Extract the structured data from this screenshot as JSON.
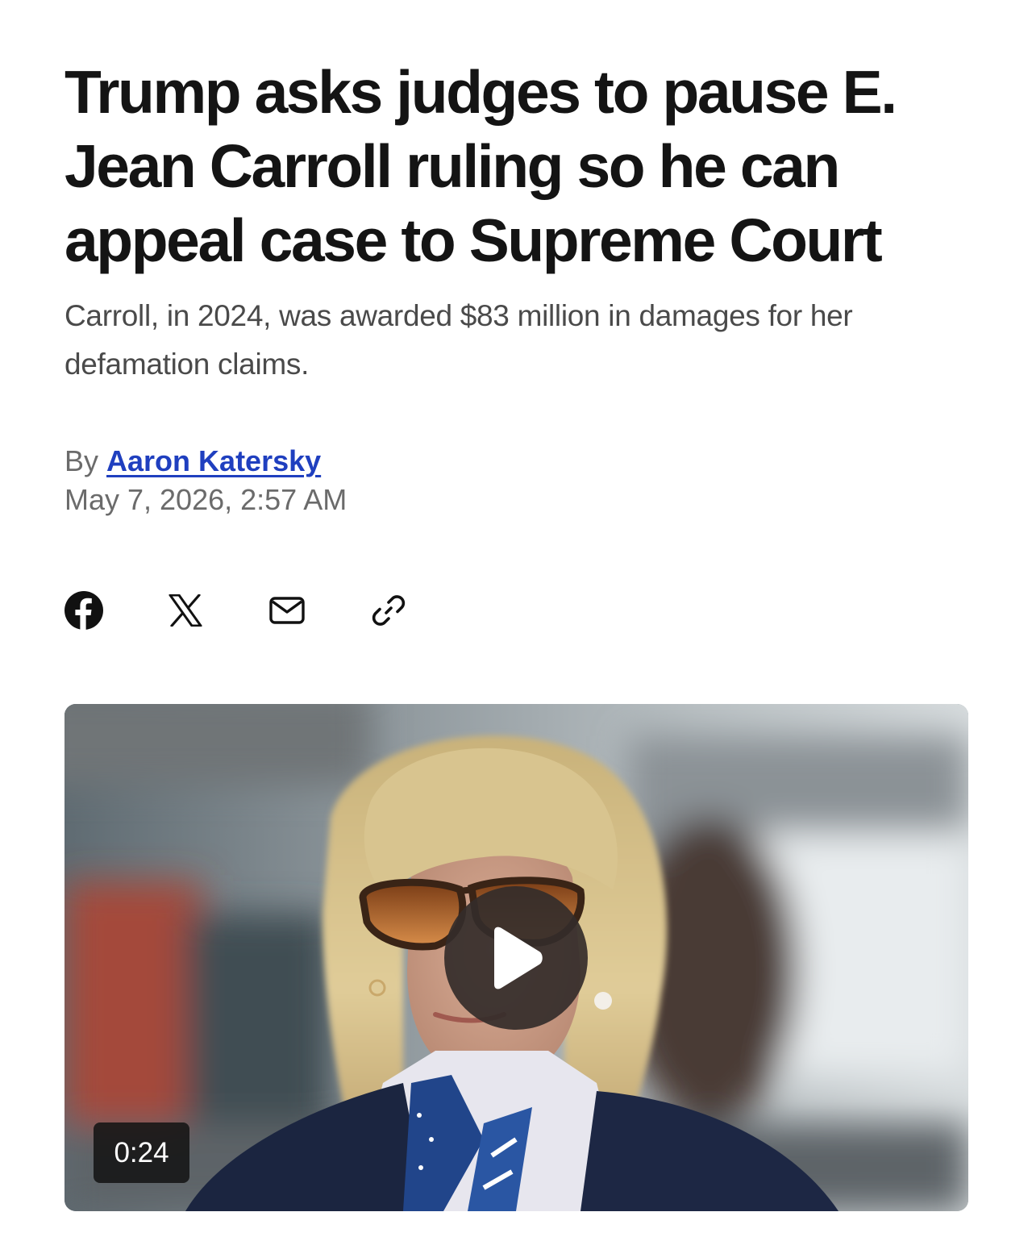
{
  "article": {
    "headline": "Trump asks judges to pause E. Jean Carroll ruling so he can appeal case to Supreme Court",
    "subheadline": "Carroll, in 2024, was awarded $83 million in damages for her defamation claims.",
    "byline_prefix": "By",
    "author": "Aaron Katersky",
    "date": "May 7, 2026, 2:57 AM"
  },
  "share": {
    "items": [
      {
        "name": "facebook",
        "icon": "facebook-icon"
      },
      {
        "name": "x",
        "icon": "x-icon"
      },
      {
        "name": "email",
        "icon": "mail-icon"
      },
      {
        "name": "copy-link",
        "icon": "link-icon"
      }
    ]
  },
  "video": {
    "duration": "0:24",
    "play_icon": "play-icon"
  },
  "colors": {
    "headline": "#141414",
    "subhead": "#4a4a4a",
    "meta": "#6b6b6b",
    "author_link": "#1f3fbf",
    "play_button": "#342c2a"
  }
}
